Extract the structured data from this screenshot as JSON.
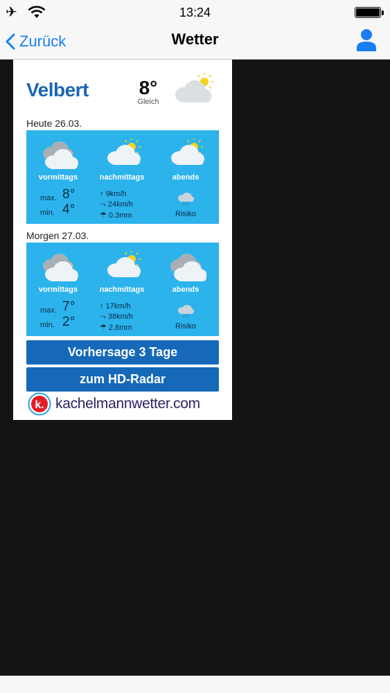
{
  "status": {
    "time": "13:24"
  },
  "nav": {
    "back_label": "Zurück",
    "title": "Wetter"
  },
  "weather": {
    "city": "Velbert",
    "current_temp": "8°",
    "trend": "Gleich",
    "days": [
      {
        "label": "Heute 26.03.",
        "periods": [
          {
            "label": "vormittags",
            "icon": "cloudy-icon"
          },
          {
            "label": "nachmittags",
            "icon": "partly-cloudy-icon"
          },
          {
            "label": "abends",
            "icon": "partly-cloudy-icon"
          }
        ],
        "max_label": "max.",
        "max": "8°",
        "min_label": "min.",
        "min": "4°",
        "wind": "9km/h",
        "gusts": "24km/h",
        "rain": "0.3mm",
        "risk_label": "Risiko"
      },
      {
        "label": "Morgen 27.03.",
        "periods": [
          {
            "label": "vormittags",
            "icon": "cloudy-icon"
          },
          {
            "label": "nachmittags",
            "icon": "partly-cloudy-icon"
          },
          {
            "label": "abends",
            "icon": "cloudy-sun-icon"
          }
        ],
        "max_label": "max.",
        "max": "7°",
        "min_label": "min.",
        "min": "2°",
        "wind": "17km/h",
        "gusts": "38km/h",
        "rain": "2.8mm",
        "risk_label": "Risiko"
      }
    ],
    "forecast_button": "Vorhersage 3 Tage",
    "radar_button": "zum HD-Radar",
    "brand": "kachelmannwetter.com",
    "brand_logo_letter": "k."
  },
  "colors": {
    "accent": "#1a7df5",
    "panel": "#2cb3ec",
    "button": "#1569b8",
    "city": "#1a66b5"
  }
}
